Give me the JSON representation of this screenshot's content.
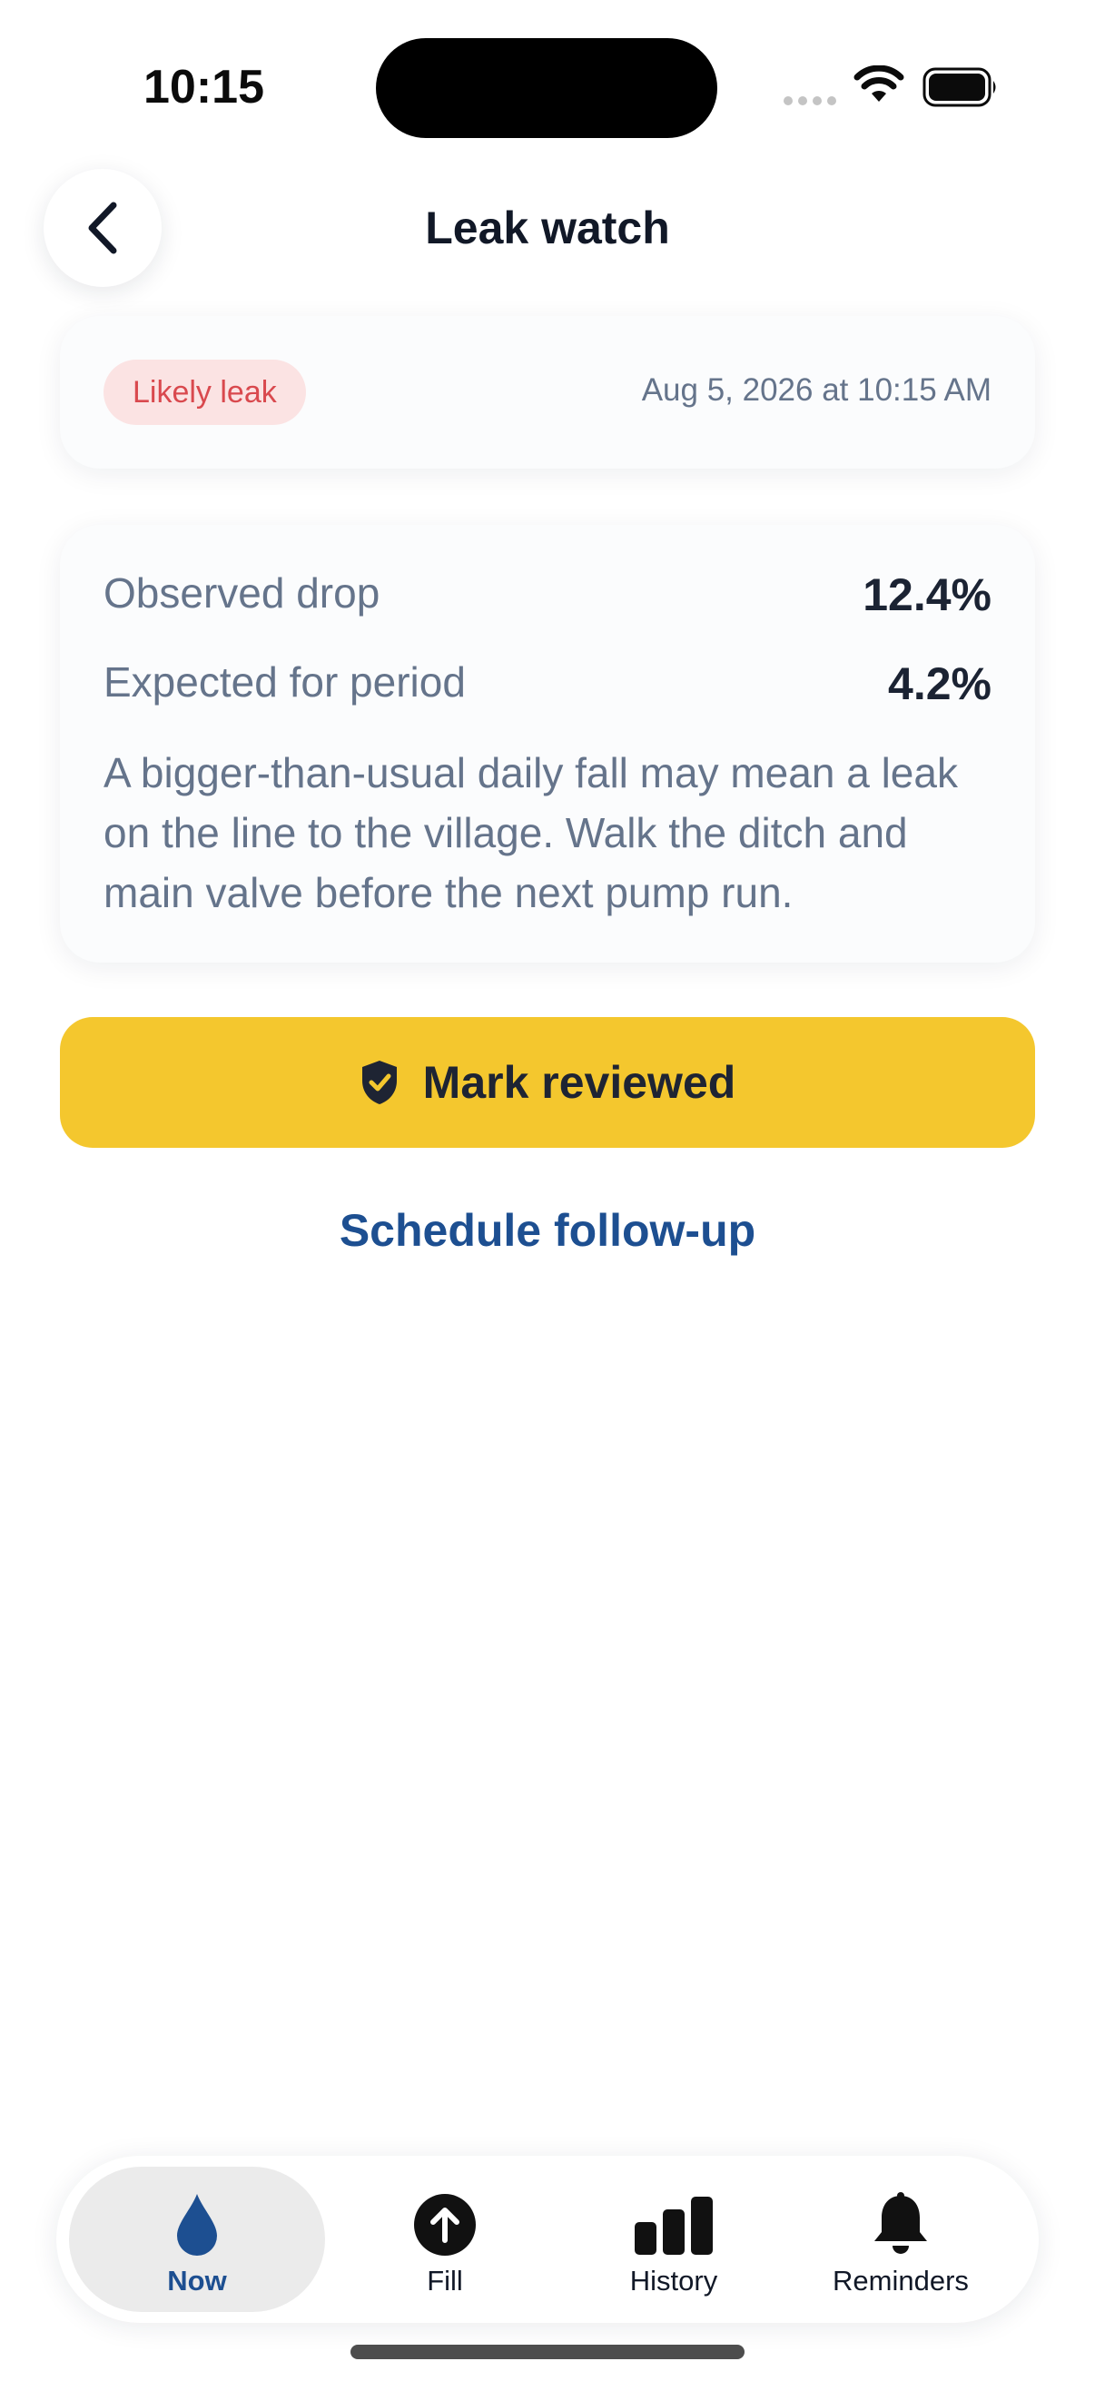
{
  "status_bar": {
    "time": "10:15"
  },
  "header": {
    "title": "Leak watch",
    "back_icon": "chevron-left-icon"
  },
  "alert": {
    "badge": "Likely leak",
    "timestamp": "Aug 5, 2026 at 10:15 AM",
    "badge_color": "#d9494e"
  },
  "metrics": {
    "observed_label": "Observed drop",
    "observed_value": "12.4%",
    "expected_label": "Expected for period",
    "expected_value": "4.2%",
    "description": "A bigger-than-usual daily fall may mean a leak on the line to the village. Walk the ditch and main valve before the next pump run."
  },
  "actions": {
    "primary_label": "Mark reviewed",
    "primary_icon": "shield-check-icon",
    "primary_color": "#f4c72e",
    "secondary_label": "Schedule follow-up",
    "secondary_color": "#1d4f91"
  },
  "tabs": [
    {
      "label": "Now",
      "icon": "water-drop-icon",
      "selected": true
    },
    {
      "label": "Fill",
      "icon": "arrow-up-circle-icon",
      "selected": false
    },
    {
      "label": "History",
      "icon": "bar-chart-icon",
      "selected": false
    },
    {
      "label": "Reminders",
      "icon": "bell-icon",
      "selected": false
    }
  ]
}
